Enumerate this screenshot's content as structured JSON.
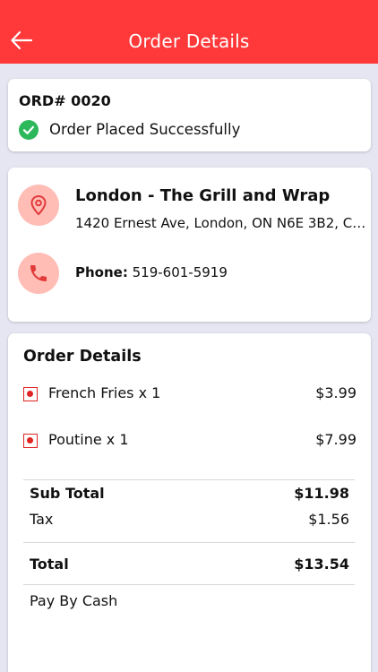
{
  "header": {
    "title": "Order Details",
    "back_icon": "arrow-left-icon",
    "color": "#ff393a"
  },
  "order": {
    "id": "ORD# 0020",
    "status": "Order Placed Successfully",
    "status_icon": "check-circle-icon",
    "status_color": "#2eb85c"
  },
  "store": {
    "name": "London - The Grill and Wrap",
    "address": "1420 Ernest Ave, London, ON N6E 3B2, Ca...",
    "phone_label": "Phone:",
    "phone": "519-601-5919",
    "location_icon": "map-pin-icon",
    "phone_icon": "phone-icon"
  },
  "details": {
    "title": "Order Details",
    "items": [
      {
        "name": "French Fries x 1",
        "price": "$3.99"
      },
      {
        "name": "Poutine x 1",
        "price": "$7.99"
      }
    ],
    "subtotal_label": "Sub Total",
    "subtotal": "$11.98",
    "tax_label": "Tax",
    "tax": "$1.56",
    "total_label": "Total",
    "total": "$13.54",
    "payment": "Pay By Cash"
  }
}
